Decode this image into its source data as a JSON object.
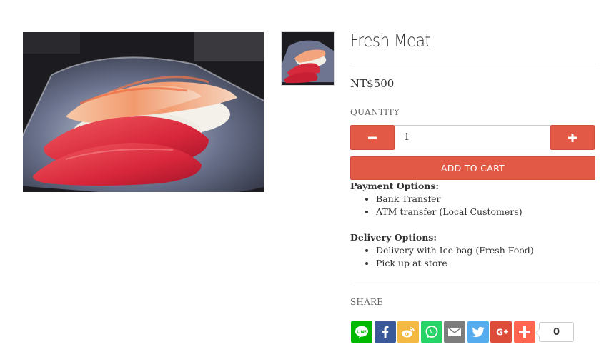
{
  "product": {
    "title": "Fresh Meat",
    "price": "NT$500"
  },
  "quantity": {
    "label": "QUANTITY",
    "value": "1",
    "minus_icon": "minus-icon",
    "plus_icon": "plus-icon"
  },
  "cart": {
    "add_label": "ADD TO CART"
  },
  "description": {
    "payment_heading": "Payment Options:",
    "payment_items": [
      "Bank Transfer",
      "ATM transfer (Local Customers)"
    ],
    "delivery_heading": "Delivery Options:",
    "delivery_items": [
      "Delivery with Ice bag (Fresh Food)",
      "Pick up at store"
    ]
  },
  "share": {
    "label": "SHARE",
    "count": "0",
    "buttons": [
      {
        "icon": "line-icon",
        "color": "#00b900"
      },
      {
        "icon": "facebook-icon",
        "color": "#3b5998"
      },
      {
        "icon": "weibo-icon",
        "color": "#f4b942"
      },
      {
        "icon": "whatsapp-icon",
        "color": "#25d366"
      },
      {
        "icon": "email-icon",
        "color": "#7d7d7d"
      },
      {
        "icon": "twitter-icon",
        "color": "#55acee"
      },
      {
        "icon": "google-plus-icon",
        "color": "#dd4b39"
      },
      {
        "icon": "add-more-icon",
        "color": "#ff6550"
      }
    ]
  },
  "colors": {
    "accent": "#e25a45"
  }
}
